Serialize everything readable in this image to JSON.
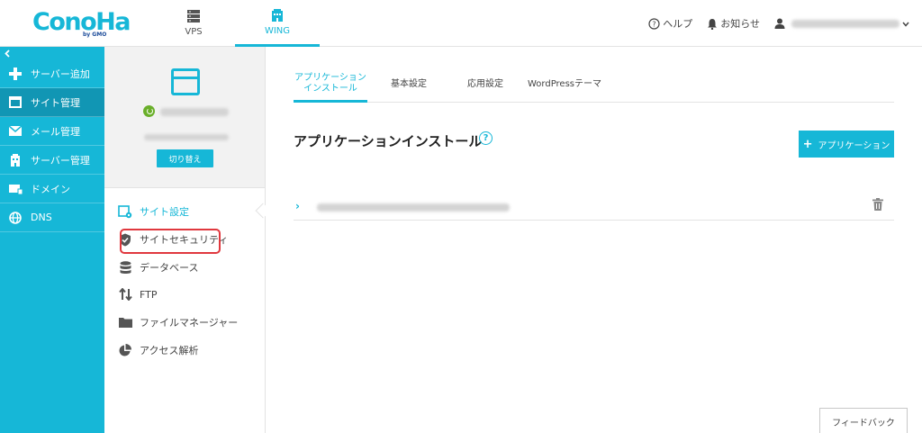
{
  "header": {
    "logo_text": "ConoHa",
    "logo_sub": "by GMO",
    "tabs": [
      {
        "label": "VPS",
        "icon": "server-icon"
      },
      {
        "label": "WING",
        "icon": "building-icon"
      }
    ],
    "help_label": "ヘルプ",
    "notice_label": "お知らせ"
  },
  "sidebar": {
    "items": [
      {
        "label": "サーバー追加",
        "icon": "plus-icon"
      },
      {
        "label": "サイト管理",
        "icon": "window-icon"
      },
      {
        "label": "メール管理",
        "icon": "envelope-icon"
      },
      {
        "label": "サーバー管理",
        "icon": "building-icon"
      },
      {
        "label": "ドメイン",
        "icon": "domain-icon"
      },
      {
        "label": "DNS",
        "icon": "globe-icon"
      }
    ]
  },
  "subpanel": {
    "switch_label": "切り替え",
    "items": [
      {
        "label": "サイト設定",
        "icon": "site-settings-icon"
      },
      {
        "label": "サイトセキュリティ",
        "icon": "shield-icon"
      },
      {
        "label": "データベース",
        "icon": "database-icon"
      },
      {
        "label": "FTP",
        "icon": "transfer-arrows-icon"
      },
      {
        "label": "ファイルマネージャー",
        "icon": "folder-icon"
      },
      {
        "label": "アクセス解析",
        "icon": "pie-chart-icon"
      }
    ]
  },
  "main": {
    "tabs": [
      {
        "label_line1": "アプリケーション",
        "label_line2": "インストール"
      },
      {
        "label": "基本設定"
      },
      {
        "label": "応用設定"
      },
      {
        "label": "WordPressテーマ"
      }
    ],
    "title": "アプリケーションインストール",
    "help_glyph": "?",
    "add_button_label": "アプリケーション",
    "add_button_glyph": "+",
    "row_chevron": "›",
    "feedback_label": "フィードバック"
  },
  "colors": {
    "accent": "#16b7d7",
    "sidebar_active": "#1196b4",
    "highlight": "#e0383e",
    "power_on": "#6aaf2a"
  }
}
